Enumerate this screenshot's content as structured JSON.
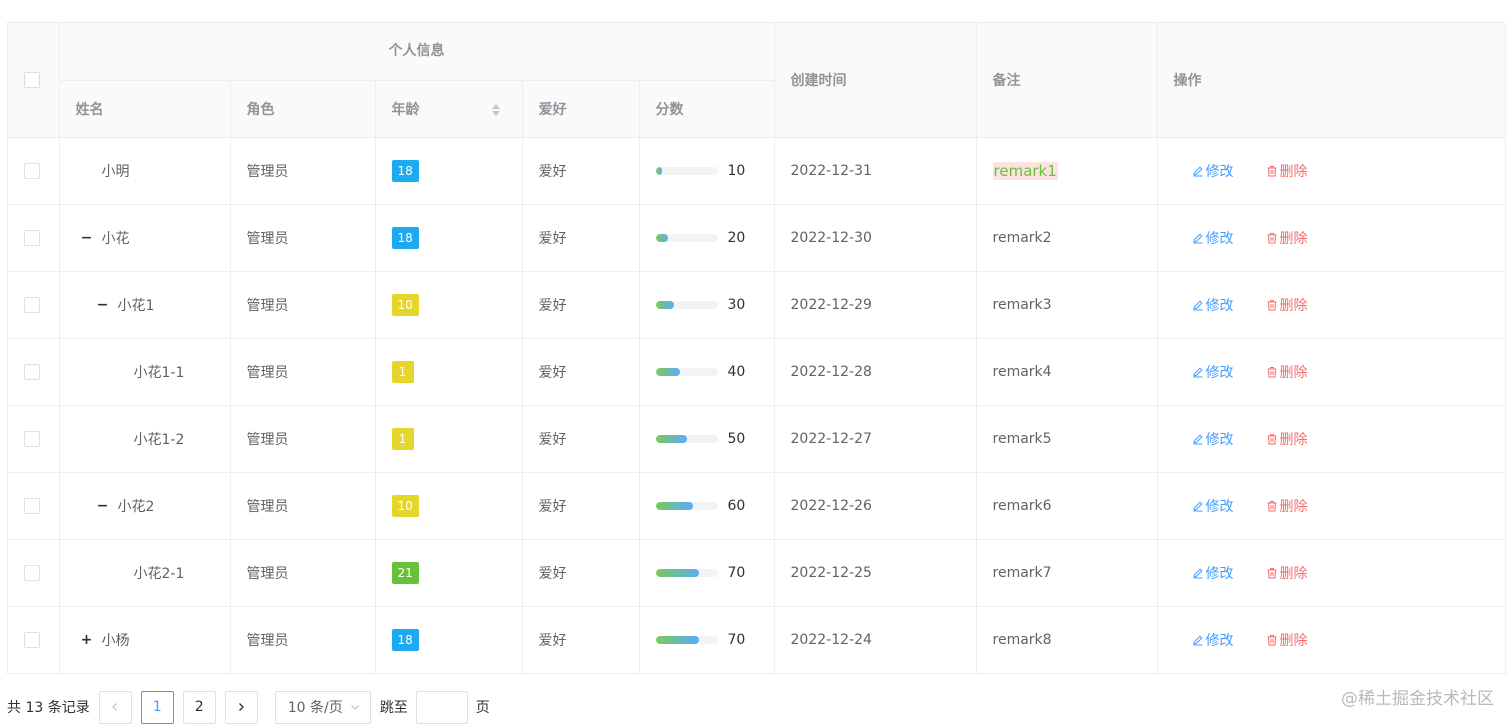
{
  "header": {
    "group_label": "个人信息",
    "name": "姓名",
    "role": "角色",
    "age": "年龄",
    "hobby": "爱好",
    "score": "分数",
    "created": "创建时间",
    "remark": "备注",
    "ops": "操作"
  },
  "rows": [
    {
      "name": "小明",
      "level": 0,
      "expander": "",
      "role": "管理员",
      "age": "18",
      "age_color": "#1eaaf1",
      "hobby": "爱好",
      "score": "10",
      "score_pct": 10,
      "created": "2022-12-31",
      "remark": "remark1",
      "highlight": true
    },
    {
      "name": "小花",
      "level": 0,
      "expander": "−",
      "role": "管理员",
      "age": "18",
      "age_color": "#1eaaf1",
      "hobby": "爱好",
      "score": "20",
      "score_pct": 20,
      "created": "2022-12-30",
      "remark": "remark2",
      "highlight": false
    },
    {
      "name": "小花1",
      "level": 1,
      "expander": "−",
      "role": "管理员",
      "age": "10",
      "age_color": "#e6d62c",
      "hobby": "爱好",
      "score": "30",
      "score_pct": 30,
      "created": "2022-12-29",
      "remark": "remark3",
      "highlight": false
    },
    {
      "name": "小花1-1",
      "level": 2,
      "expander": "",
      "role": "管理员",
      "age": "1",
      "age_color": "#e6d62c",
      "hobby": "爱好",
      "score": "40",
      "score_pct": 40,
      "created": "2022-12-28",
      "remark": "remark4",
      "highlight": false
    },
    {
      "name": "小花1-2",
      "level": 2,
      "expander": "",
      "role": "管理员",
      "age": "1",
      "age_color": "#e6d62c",
      "hobby": "爱好",
      "score": "50",
      "score_pct": 50,
      "created": "2022-12-27",
      "remark": "remark5",
      "highlight": false
    },
    {
      "name": "小花2",
      "level": 1,
      "expander": "−",
      "role": "管理员",
      "age": "10",
      "age_color": "#e6d62c",
      "hobby": "爱好",
      "score": "60",
      "score_pct": 60,
      "created": "2022-12-26",
      "remark": "remark6",
      "highlight": false
    },
    {
      "name": "小花2-1",
      "level": 2,
      "expander": "",
      "role": "管理员",
      "age": "21",
      "age_color": "#67c23a",
      "hobby": "爱好",
      "score": "70",
      "score_pct": 70,
      "created": "2022-12-25",
      "remark": "remark7",
      "highlight": false
    },
    {
      "name": "小杨",
      "level": 0,
      "expander": "+",
      "role": "管理员",
      "age": "18",
      "age_color": "#1eaaf1",
      "hobby": "爱好",
      "score": "70",
      "score_pct": 70,
      "created": "2022-12-24",
      "remark": "remark8",
      "highlight": false
    }
  ],
  "actions": {
    "edit": "修改",
    "delete": "删除",
    "edit_icon": "edit-icon",
    "delete_icon": "trash-icon"
  },
  "pagination": {
    "total_text": "共 13 条记录",
    "pages": [
      "1",
      "2"
    ],
    "current": "1",
    "page_size": "10 条/页",
    "jump_label": "跳至",
    "jump_suffix": "页"
  },
  "watermark": "@稀土掘金技术社区",
  "colors": {
    "primary": "#409eff",
    "danger": "#f56c6c",
    "success": "#67c23a"
  }
}
